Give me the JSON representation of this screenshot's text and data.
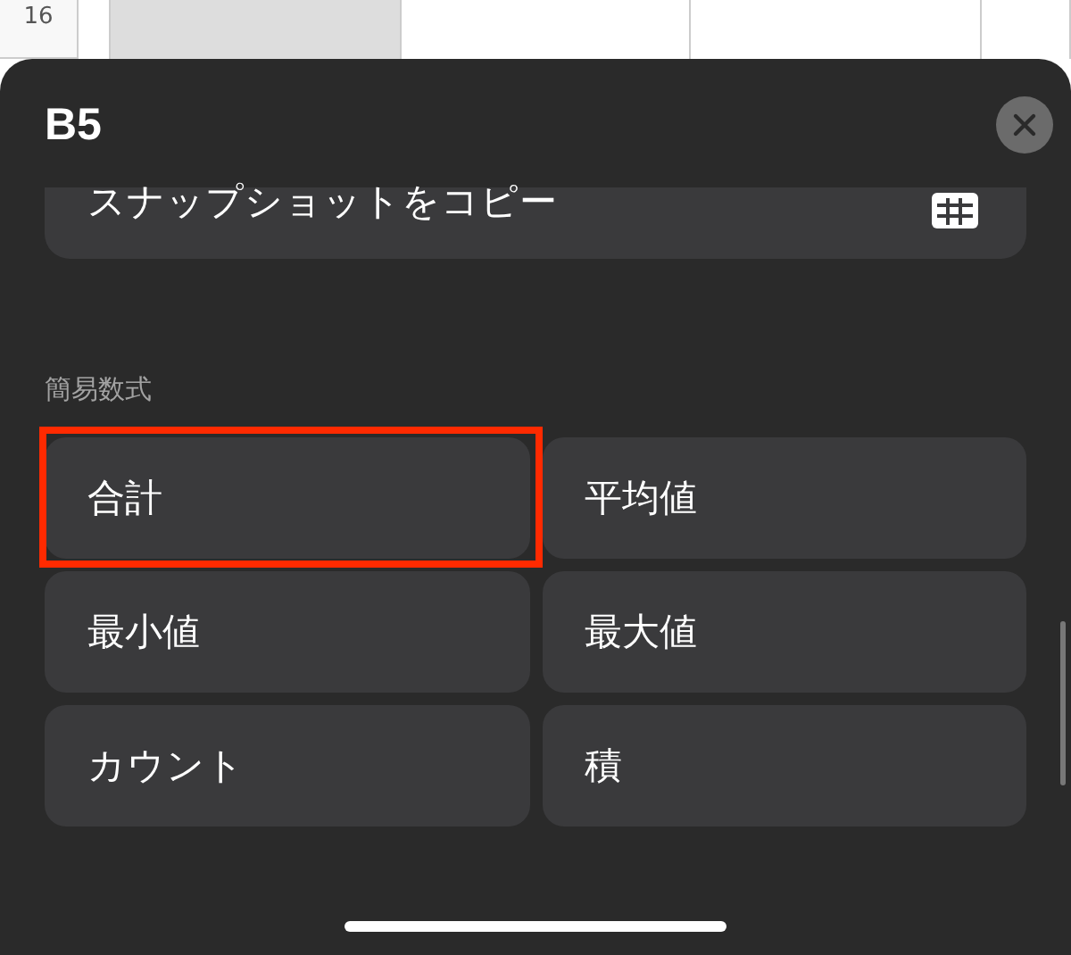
{
  "spreadsheet": {
    "row_label": "16",
    "cells": [
      {
        "selected": false
      },
      {
        "selected": true
      },
      {
        "selected": false
      },
      {
        "selected": false
      },
      {
        "selected": false
      }
    ]
  },
  "sheet": {
    "title": "B5",
    "copy_action": {
      "label": "スナップショットをコピー"
    }
  },
  "quick_formulas": {
    "heading": "簡易数式",
    "items": [
      {
        "label": "合計",
        "highlighted": true
      },
      {
        "label": "平均値",
        "highlighted": false
      },
      {
        "label": "最小値",
        "highlighted": false
      },
      {
        "label": "最大値",
        "highlighted": false
      },
      {
        "label": "カウント",
        "highlighted": false
      },
      {
        "label": "積",
        "highlighted": false
      }
    ]
  }
}
